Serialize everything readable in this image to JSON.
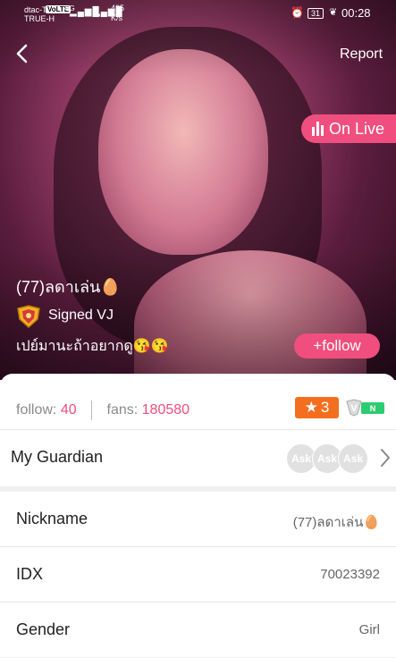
{
  "status_bar": {
    "carrier_top": "dtac-T",
    "carrier_bottom": "TRUE-H",
    "network": "VoLTE",
    "signal_1": "4G",
    "speed": "435",
    "speed_unit": "K/s",
    "battery": "31",
    "time": "00:28"
  },
  "header": {
    "report_label": "Report"
  },
  "live": {
    "on_live_label": "On Live",
    "vj_name": "(77)ลดาเล่น🥚",
    "signed_label": "Signed VJ",
    "description": "เปย์มานะถ้าอยากดู😘😘",
    "follow_button": "+follow"
  },
  "profile": {
    "follow_label": "follow:",
    "follow_count": "40",
    "fans_label": "fans:",
    "fans_count": "180580",
    "level": "3",
    "guardian_label": "My Guardian",
    "guardian_avatars": [
      "Ask",
      "Ask",
      "Ask"
    ],
    "rows": [
      {
        "label": "Nickname",
        "value": "(77)ลดาเล่น🥚"
      },
      {
        "label": "IDX",
        "value": "70023392"
      },
      {
        "label": "Gender",
        "value": "Girl"
      }
    ]
  },
  "colors": {
    "accent_pink": "#f04e7e",
    "level_orange": "#f36f1f",
    "vip_green": "#2ecc71"
  }
}
